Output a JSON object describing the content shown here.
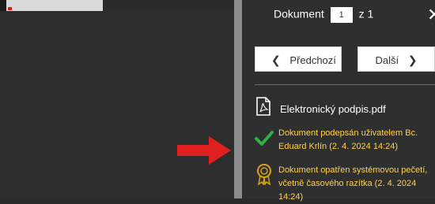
{
  "document_nav": {
    "label": "Dokument",
    "current_page": "1",
    "total_label": "z 1"
  },
  "buttons": {
    "prev_label": "Předchozí",
    "next_label": "Další"
  },
  "file": {
    "name": "Elektronický podpis.pdf"
  },
  "statuses": [
    {
      "line1": "Dokument podepsán uživatelem Bc.",
      "line2": "Eduard Krlín (2. 4. 2024 14:24)"
    },
    {
      "line1": "Dokument opatřen systémovou pečetí,",
      "line2": "včetně časového razítka (2. 4. 2024 14:24)"
    }
  ],
  "icons": {
    "close": "close-icon",
    "prev": "chevron-left-icon",
    "next": "chevron-right-icon",
    "pdf": "pdf-file-icon",
    "check": "checkmark-icon",
    "seal": "seal-badge-icon",
    "arrow": "red-arrow-icon"
  },
  "colors": {
    "panel_bg": "#2f2f2f",
    "viewer_bg": "#2d2d2d",
    "status_text": "#ffd24d",
    "check": "#2fae4a",
    "seal": "#d6a21e",
    "arrow": "#e0201f"
  }
}
